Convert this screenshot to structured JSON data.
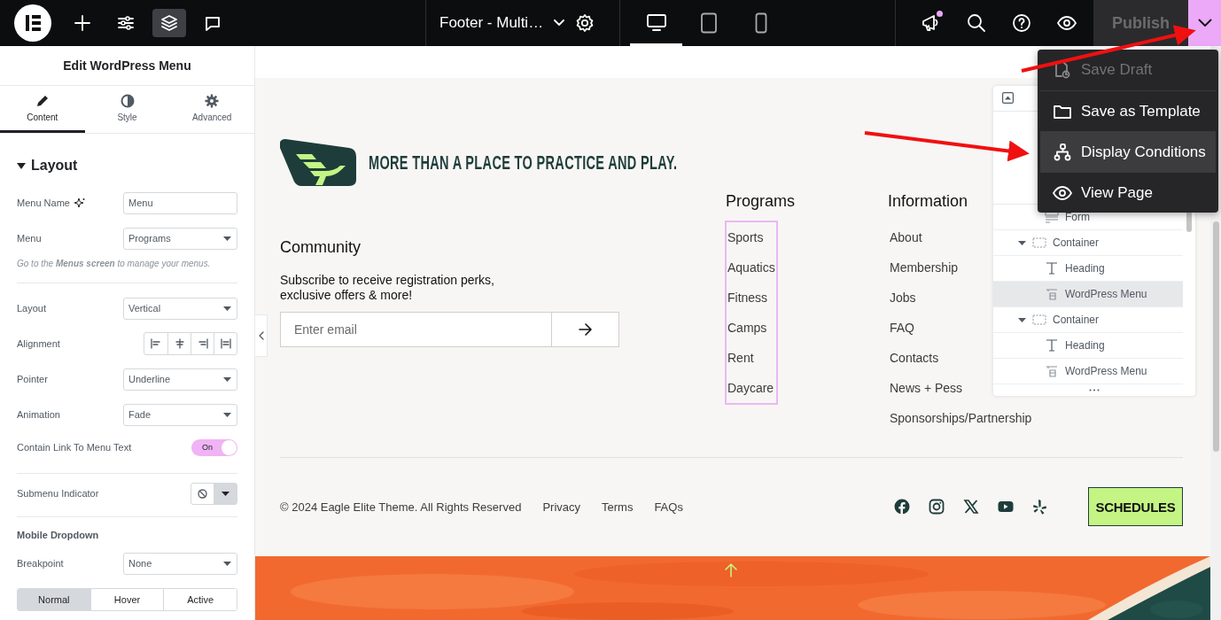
{
  "topbar": {
    "tools": [
      {
        "kind": "add",
        "selected": false
      },
      {
        "kind": "settings",
        "selected": false
      },
      {
        "kind": "structure",
        "selected": true
      },
      {
        "kind": "notes",
        "selected": false
      }
    ],
    "document_title": "Footer - Multi…",
    "devices": [
      {
        "kind": "desktop",
        "selected": true
      },
      {
        "kind": "tablet",
        "selected": false
      },
      {
        "kind": "mobile",
        "selected": false
      }
    ],
    "announcements_unread": true,
    "publish": {
      "label": "Publish",
      "disabled": true
    },
    "more_open": true
  },
  "panel": {
    "title": "Edit WordPress Menu",
    "tabs": [
      {
        "label": "Content",
        "kind": "content",
        "selected": true
      },
      {
        "label": "Style",
        "kind": "style",
        "selected": false
      },
      {
        "label": "Advanced",
        "kind": "advanced",
        "selected": false
      }
    ],
    "section": {
      "title": "Layout",
      "expanded": true
    },
    "controls": [
      {
        "kind": "text",
        "label": "Menu Name",
        "value": "Menu"
      },
      {
        "kind": "select",
        "label": "Menu",
        "value": "Programs"
      },
      {
        "kind": "help",
        "text": "Go to the **Menus screen** to manage your menus."
      },
      {
        "kind": "divider"
      },
      {
        "kind": "select",
        "label": "Layout",
        "value": "Vertical"
      },
      {
        "kind": "align",
        "label": "Alignment"
      },
      {
        "kind": "select",
        "label": "Pointer",
        "value": "Underline"
      },
      {
        "kind": "select",
        "label": "Animation",
        "value": "Fade"
      },
      {
        "kind": "toggle",
        "label": "Contain Link To Menu Text",
        "on": true,
        "text": "On"
      },
      {
        "kind": "divider"
      },
      {
        "kind": "icon_select",
        "label": "Submenu Indicator"
      },
      {
        "kind": "divider"
      },
      {
        "kind": "heading",
        "label": "Mobile Dropdown"
      },
      {
        "kind": "select",
        "label": "Breakpoint",
        "value": "None"
      },
      {
        "kind": "segmented",
        "options": [
          {
            "label": "Normal",
            "selected": true
          },
          {
            "label": "Hover",
            "selected": false
          },
          {
            "label": "Active",
            "selected": false
          }
        ]
      }
    ]
  },
  "footer": {
    "tagline": "MORE THAN A PLACE TO PRACTICE AND PLAY.",
    "community": {
      "title": "Community",
      "text": "Subscribe to receive registration perks, exclusive offers & more!",
      "email_placeholder": "Enter email"
    },
    "menus": [
      {
        "title": "Programs",
        "highlighted": true,
        "items": [
          "Sports",
          "Aquatics",
          "Fitness",
          "Camps",
          "Rent",
          "Daycare"
        ]
      },
      {
        "title": "Information",
        "highlighted": false,
        "items": [
          "About",
          "Membership",
          "Jobs",
          "FAQ",
          "Contacts",
          "News + Pess",
          "Sponsorships/Partnership"
        ]
      }
    ],
    "copyright": "© 2024 Eagle Elite Theme. All Rights Reserved",
    "links": [
      "Privacy",
      "Terms",
      "FAQs"
    ],
    "social": [
      {
        "kind": "facebook"
      },
      {
        "kind": "instagram"
      },
      {
        "kind": "x"
      },
      {
        "kind": "youtube"
      },
      {
        "kind": "yelp"
      }
    ],
    "cta": "SCHEDULES"
  },
  "navigator": {
    "items": [
      {
        "label": "Form",
        "kind": "form",
        "selected": false
      },
      {
        "label": "Container",
        "kind": "container",
        "selected": false,
        "expanded": true,
        "children": [
          {
            "label": "Heading",
            "kind": "heading",
            "selected": false
          },
          {
            "label": "WordPress Menu",
            "kind": "menu",
            "selected": true
          }
        ]
      },
      {
        "label": "Container",
        "kind": "container",
        "selected": false,
        "expanded": true,
        "children": [
          {
            "label": "Heading",
            "kind": "heading",
            "selected": false
          },
          {
            "label": "WordPress Menu",
            "kind": "menu",
            "selected": false
          }
        ]
      }
    ]
  },
  "publish_menu": {
    "items": [
      {
        "label": "Save Draft",
        "kind": "draft",
        "disabled": true,
        "selected": false
      },
      {
        "label": "Save as Template",
        "kind": "template",
        "disabled": false,
        "selected": false
      },
      {
        "label": "Display Conditions",
        "kind": "conditions",
        "disabled": false,
        "selected": true
      },
      {
        "label": "View Page",
        "kind": "view",
        "disabled": false,
        "selected": false
      }
    ]
  }
}
